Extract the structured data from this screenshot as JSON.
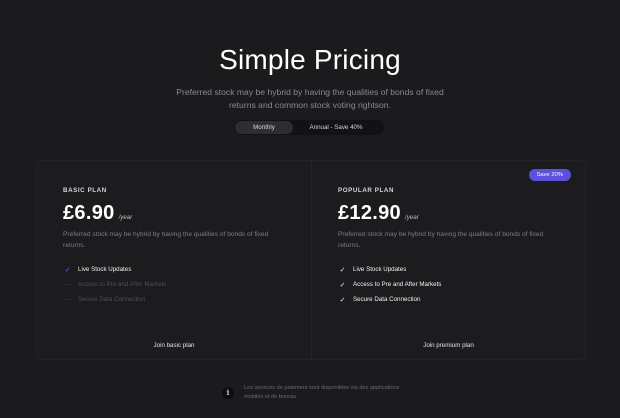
{
  "header": {
    "title": "Simple Pricing",
    "subtitle": "Preferred stock may be hybrid by having the qualities of bonds of fixed returns and common stock voting rightson."
  },
  "billing_toggle": {
    "monthly_label": "Monthly",
    "annual_label": "Annual - Save 40%",
    "selected": "Monthly"
  },
  "plans": [
    {
      "label": "BASIC PLAN",
      "price": "£6.90",
      "period": "/year",
      "description": "Preferred stock may be hybrid by having the qualities of bonds of fixed returns.",
      "features": [
        {
          "text": "Live Stock Updates",
          "enabled": true
        },
        {
          "text": "Access to Pre and After Markets",
          "enabled": false
        },
        {
          "text": "Secure Data Connection",
          "enabled": false
        }
      ],
      "cta": "Join basic plan"
    },
    {
      "label": "POPULAR PLAN",
      "badge": "Save 20%",
      "price": "£12.90",
      "period": "/year",
      "description": "Preferred stock may be hybrid by having the qualities of bonds of fixed returns.",
      "features": [
        {
          "text": "Live Stock Updates",
          "enabled": true
        },
        {
          "text": "Access to Pre and After Markets",
          "enabled": true
        },
        {
          "text": "Secure Data Connection",
          "enabled": true
        }
      ],
      "cta": "Join premium plan"
    }
  ],
  "footer": {
    "icon": "info-icon",
    "text": "Les services de paiement sont disponibles via des applications mobiles et de bureau."
  },
  "colors": {
    "background": "#1b1b1d",
    "accent": "#5d4fe0",
    "text_primary": "#ffffff",
    "text_muted": "#7e7e83"
  }
}
